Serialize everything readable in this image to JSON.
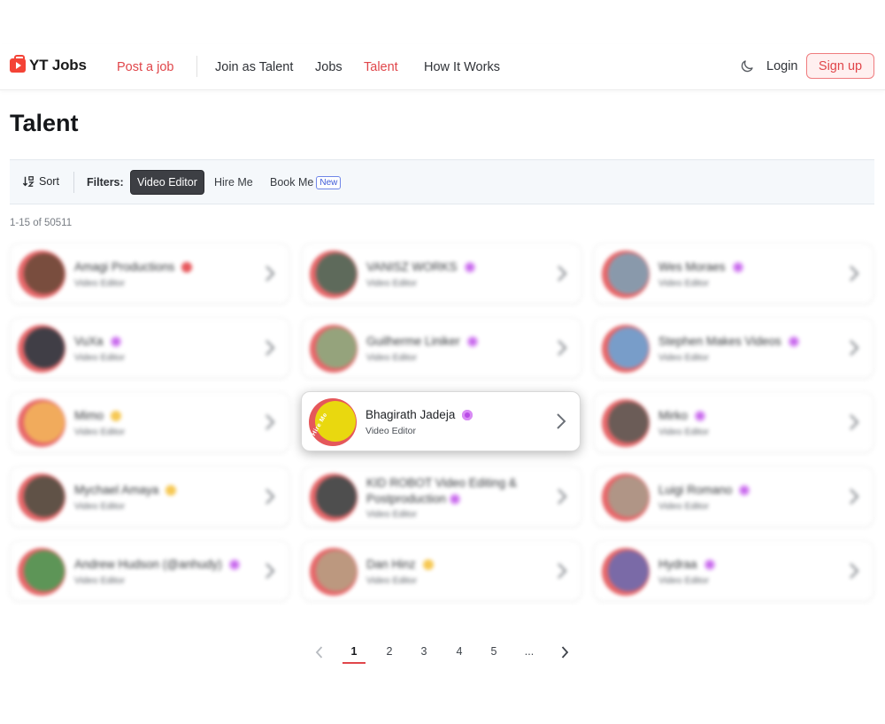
{
  "header": {
    "brand": "YT Jobs",
    "post_job": "Post a job",
    "nav": [
      "Join as Talent",
      "Jobs",
      "Talent",
      "How It Works"
    ],
    "login": "Login",
    "signup": "Sign up",
    "accent": "#e0464a"
  },
  "page": {
    "title": "Talent",
    "sort_label": "Sort",
    "filters_label": "Filters:",
    "filters": [
      "Video Editor",
      "Hire Me",
      "Book Me"
    ],
    "active_filter": "Video Editor",
    "new_badge": "New",
    "count": "1-15 of 50511"
  },
  "cards": [
    {
      "name": "Amagi Productions",
      "role": "Video Editor",
      "badge": "red",
      "avatar_color": "#6b3a2a"
    },
    {
      "name": "VANISZ WORKS",
      "role": "Video Editor",
      "badge": "purple",
      "avatar_color": "#4d5a4a"
    },
    {
      "name": "Wes Moraes",
      "role": "Video Editor",
      "badge": "purple",
      "avatar_color": "#7d8fa3"
    },
    {
      "name": "VuXa",
      "role": "Video Editor",
      "badge": "purple",
      "avatar_color": "#2c2a33"
    },
    {
      "name": "Guilherme Liniker",
      "role": "Video Editor",
      "badge": "purple",
      "avatar_color": "#8a9a6e"
    },
    {
      "name": "Stephen Makes Videos",
      "role": "Video Editor",
      "badge": "purple",
      "avatar_color": "#6a93c4"
    },
    {
      "name": "Mimo",
      "role": "Video Editor",
      "badge": "yellow",
      "avatar_color": "#f0a34b"
    },
    {
      "name": "Bhagirath Jadeja",
      "role": "Video Editor",
      "badge": "purple",
      "avatar_color": "#e9d80f",
      "tag": "Hire Me"
    },
    {
      "name": "Mirko",
      "role": "Video Editor",
      "badge": "purple",
      "avatar_color": "#5c4b45"
    },
    {
      "name": "Mychael Amaya",
      "role": "Video Editor",
      "badge": "yellow",
      "avatar_color": "#4f4034"
    },
    {
      "name": "KID ROBOT Video Editing & Postproduction",
      "role": "Video Editor",
      "badge": "purple",
      "avatar_color": "#3b3b3b"
    },
    {
      "name": "Luigi Romano",
      "role": "Video Editor",
      "badge": "purple",
      "avatar_color": "#a88a79"
    },
    {
      "name": "Andrew Hudson (@anhudy)",
      "role": "Video Editor",
      "badge": "purple",
      "avatar_color": "#4c8a45"
    },
    {
      "name": "Dan Hinz",
      "role": "Video Editor",
      "badge": "yellow",
      "avatar_color": "#b58d72"
    },
    {
      "name": "Hydraa",
      "role": "Video Editor",
      "badge": "purple",
      "avatar_color": "#6c5a9e"
    }
  ],
  "pagination": {
    "pages": [
      "1",
      "2",
      "3",
      "4",
      "5",
      "..."
    ],
    "current": "1"
  }
}
